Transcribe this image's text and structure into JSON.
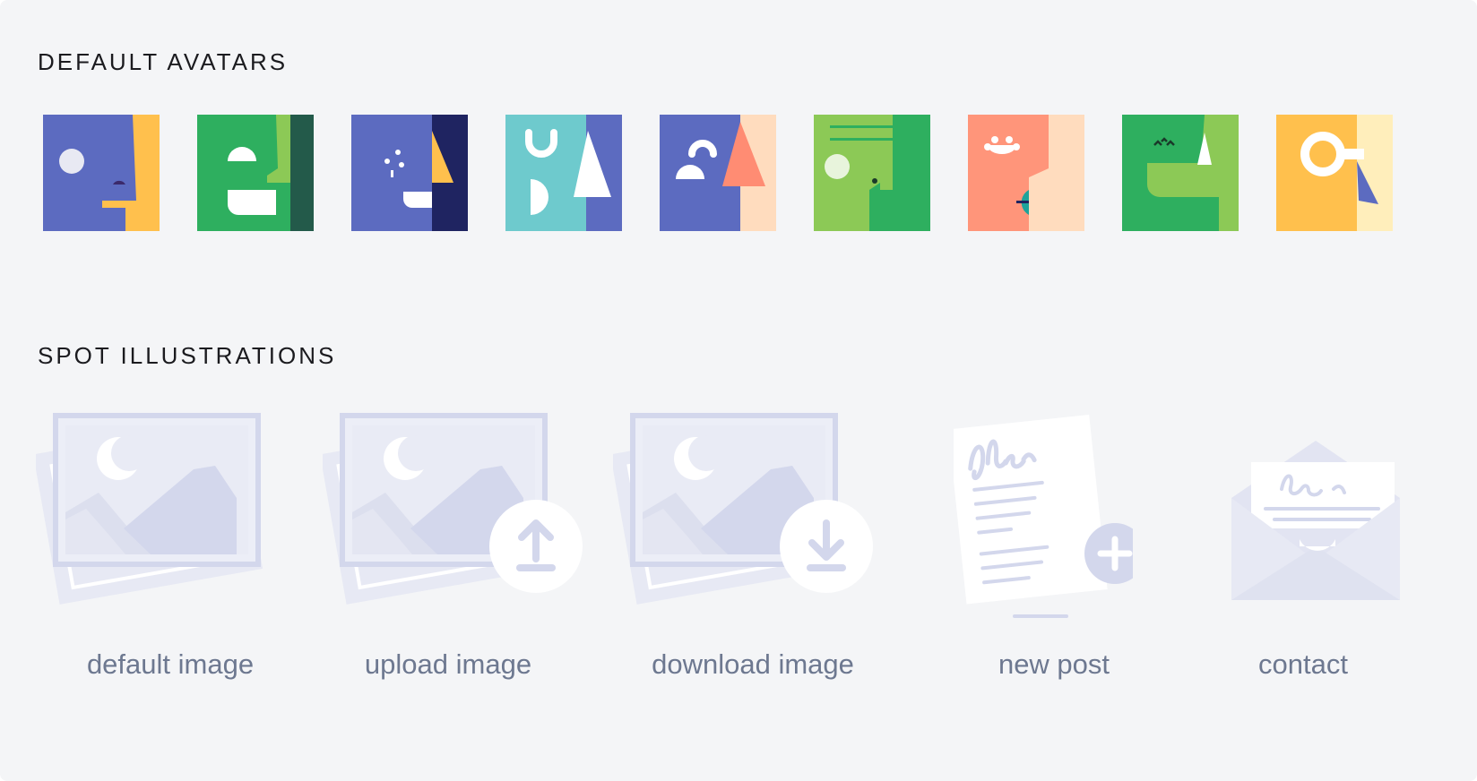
{
  "sections": {
    "avatars_title": "DEFAULT AVATARS",
    "spots_title": "SPOT ILLUSTRATIONS"
  },
  "avatars": [
    {
      "name": "avatar-1",
      "colors": [
        "#5c6bc0",
        "#ffc04d"
      ]
    },
    {
      "name": "avatar-2",
      "colors": [
        "#2eaf5f",
        "#8cc956",
        "#235a4a"
      ]
    },
    {
      "name": "avatar-3",
      "colors": [
        "#5c6bc0",
        "#1f2461",
        "#ffc04d"
      ]
    },
    {
      "name": "avatar-4",
      "colors": [
        "#6ecacd",
        "#5c6bc0"
      ]
    },
    {
      "name": "avatar-5",
      "colors": [
        "#5c6bc0",
        "#ffdcbe",
        "#ff8c73"
      ]
    },
    {
      "name": "avatar-6",
      "colors": [
        "#8cc956",
        "#2eaf5f"
      ]
    },
    {
      "name": "avatar-7",
      "colors": [
        "#ff957a",
        "#ffdcbe",
        "#1ea39a"
      ]
    },
    {
      "name": "avatar-8",
      "colors": [
        "#2eaf5f",
        "#8cc956"
      ]
    },
    {
      "name": "avatar-9",
      "colors": [
        "#ffc04d",
        "#ffeebb",
        "#5c6bc0"
      ]
    }
  ],
  "spots": [
    {
      "icon": "default-image-illustration",
      "label": "default image"
    },
    {
      "icon": "upload-image-illustration",
      "label": "upload image"
    },
    {
      "icon": "download-image-illustration",
      "label": "download image"
    },
    {
      "icon": "new-post-illustration",
      "label": "new post"
    },
    {
      "icon": "contact-illustration",
      "label": "contact"
    }
  ],
  "colors": {
    "background": "#f4f5f7",
    "illustration_light": "#e7e9f4",
    "illustration_mid": "#d3d7ec",
    "caption": "#6d7890"
  }
}
